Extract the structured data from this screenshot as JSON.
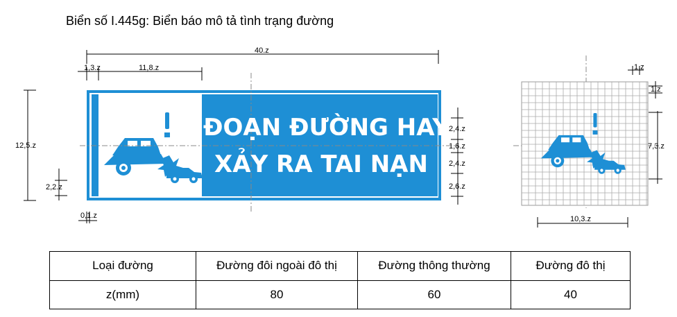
{
  "title": "Biển số I.445g: Biển báo mô tả tình trạng đường",
  "sign": {
    "line1": "ĐOẠN ĐƯỜNG HAY",
    "line2": "XẢY RA TAI NẠN",
    "background_color": "#1e8fd5",
    "border_color": "#1e8fd5",
    "symbol_color": "#1e8fd5"
  },
  "dimensions": {
    "total_width": "40.z",
    "left_margin": "1,3.z",
    "symbol_panel_width": "11,8.z",
    "total_height": "12,5.z",
    "car_offset": "2,2.z",
    "border": "0,1.z",
    "right_1": "2,4.z",
    "right_2": "1,6.z",
    "right_3": "2,4.z",
    "right_4": "2,6.z"
  },
  "grid_dimensions": {
    "cell_h": "1.z",
    "cell_v": "1.z",
    "height": "7,3.z",
    "width": "10,3.z"
  },
  "table": {
    "headers": [
      "Loại đường",
      "Đường đôi ngoài đô thị",
      "Đường thông thường",
      "Đường đô thị"
    ],
    "row": [
      "z(mm)",
      "80",
      "60",
      "40"
    ]
  }
}
